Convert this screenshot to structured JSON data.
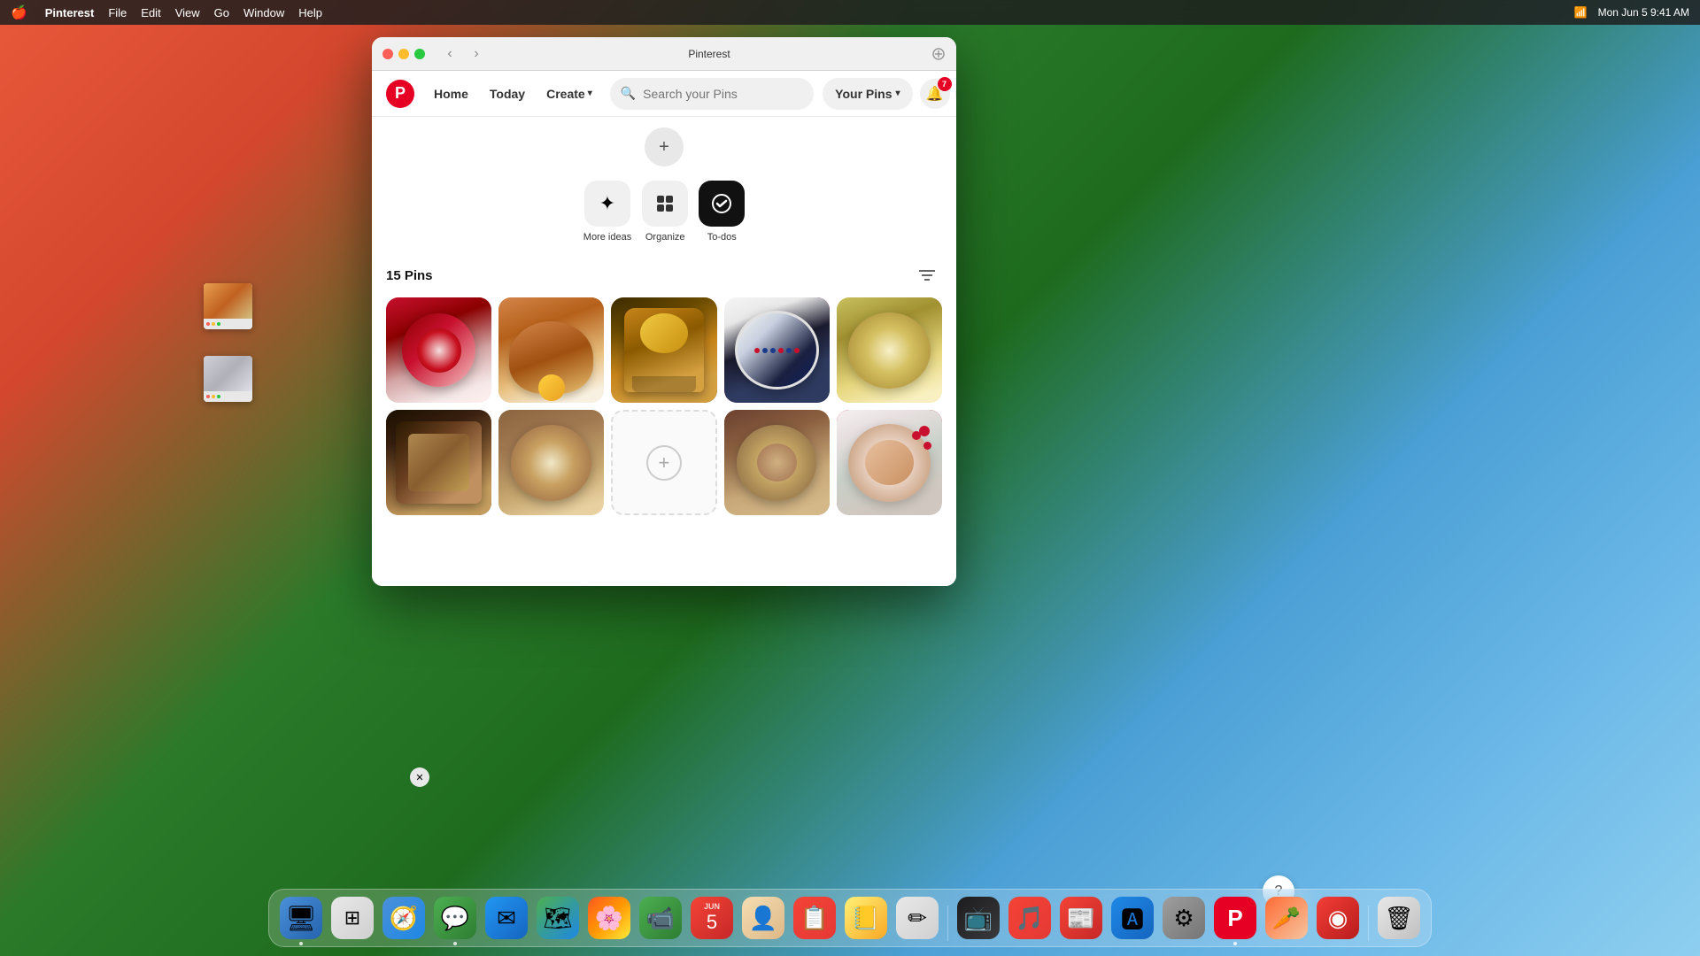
{
  "app": {
    "title": "Pinterest",
    "window_title": "Pinterest"
  },
  "menubar": {
    "apple": "🍎",
    "app_name": "Pinterest",
    "menus": [
      "File",
      "Edit",
      "View",
      "Go",
      "Window",
      "Help"
    ],
    "time": "Mon Jun 5  9:41 AM"
  },
  "browser": {
    "title": "Pinterest"
  },
  "nav": {
    "logo_letter": "P",
    "home_label": "Home",
    "today_label": "Today",
    "create_label": "Create",
    "search_placeholder": "Search your Pins",
    "your_pins_label": "Your Pins",
    "chevron": "▾"
  },
  "board": {
    "add_label": "+",
    "actions": [
      {
        "icon": "✦",
        "label": "More ideas",
        "active": false
      },
      {
        "icon": "⧉",
        "label": "Organize",
        "active": false
      },
      {
        "icon": "✓",
        "label": "To-dos",
        "active": true
      }
    ]
  },
  "pins": {
    "count_label": "15 Pins",
    "filter_icon": "≡",
    "add_more_icon": "+",
    "items": [
      {
        "id": 1,
        "type": "food",
        "style": "food-1"
      },
      {
        "id": 2,
        "type": "food",
        "style": "food-2"
      },
      {
        "id": 3,
        "type": "food",
        "style": "food-3"
      },
      {
        "id": 4,
        "type": "food",
        "style": "food-4"
      },
      {
        "id": 5,
        "type": "food",
        "style": "food-5"
      },
      {
        "id": 6,
        "type": "food",
        "style": "food-6"
      },
      {
        "id": 7,
        "type": "food",
        "style": "food-7"
      },
      {
        "id": 8,
        "type": "food",
        "style": "food-8"
      },
      {
        "id": 9,
        "type": "food",
        "style": "food-9"
      },
      {
        "id": 10,
        "type": "add",
        "style": ""
      }
    ]
  },
  "dock": {
    "items": [
      {
        "id": "finder",
        "emoji": "🔵",
        "label": "Finder",
        "has_dot": true
      },
      {
        "id": "launchpad",
        "emoji": "⊞",
        "label": "Launchpad",
        "has_dot": false
      },
      {
        "id": "safari",
        "emoji": "🧭",
        "label": "Safari",
        "has_dot": false
      },
      {
        "id": "messages",
        "emoji": "💬",
        "label": "Messages",
        "has_dot": true
      },
      {
        "id": "mail",
        "emoji": "✉",
        "label": "Mail",
        "has_dot": false
      },
      {
        "id": "maps",
        "emoji": "🗺",
        "label": "Maps",
        "has_dot": false
      },
      {
        "id": "photos",
        "emoji": "🌸",
        "label": "Photos",
        "has_dot": false
      },
      {
        "id": "facetime",
        "emoji": "📹",
        "label": "FaceTime",
        "has_dot": false
      },
      {
        "id": "calendar",
        "emoji": "📅",
        "label": "Calendar",
        "has_dot": false
      },
      {
        "id": "contacts",
        "emoji": "👤",
        "label": "Contacts",
        "has_dot": false
      },
      {
        "id": "reminders",
        "emoji": "📝",
        "label": "Reminders",
        "has_dot": false
      },
      {
        "id": "notes",
        "emoji": "📒",
        "label": "Notes",
        "has_dot": false
      },
      {
        "id": "freeform",
        "emoji": "✏",
        "label": "Freeform",
        "has_dot": false
      },
      {
        "id": "appletv",
        "emoji": "📺",
        "label": "Apple TV",
        "has_dot": false
      },
      {
        "id": "music",
        "emoji": "🎵",
        "label": "Music",
        "has_dot": false
      },
      {
        "id": "news",
        "emoji": "📰",
        "label": "News",
        "has_dot": false
      },
      {
        "id": "appstore",
        "emoji": "🅰",
        "label": "App Store",
        "has_dot": false
      },
      {
        "id": "systemsettings",
        "emoji": "⚙",
        "label": "System Settings",
        "has_dot": false
      },
      {
        "id": "pinterest",
        "emoji": "P",
        "label": "Pinterest",
        "has_dot": true
      },
      {
        "id": "carrot",
        "emoji": "🥕",
        "label": "Carrot Weather",
        "has_dot": false
      },
      {
        "id": "pocketcasts",
        "emoji": "◉",
        "label": "Pocketcasts",
        "has_dot": false
      },
      {
        "id": "trash",
        "emoji": "🗑",
        "label": "Trash",
        "has_dot": false
      }
    ]
  },
  "help": {
    "label": "?"
  },
  "colors": {
    "pinterest_red": "#e60023",
    "nav_bg": "#ffffff",
    "search_bg": "#f0f0f0",
    "action_active_bg": "#111111",
    "action_inactive_bg": "#f0f0f0"
  }
}
